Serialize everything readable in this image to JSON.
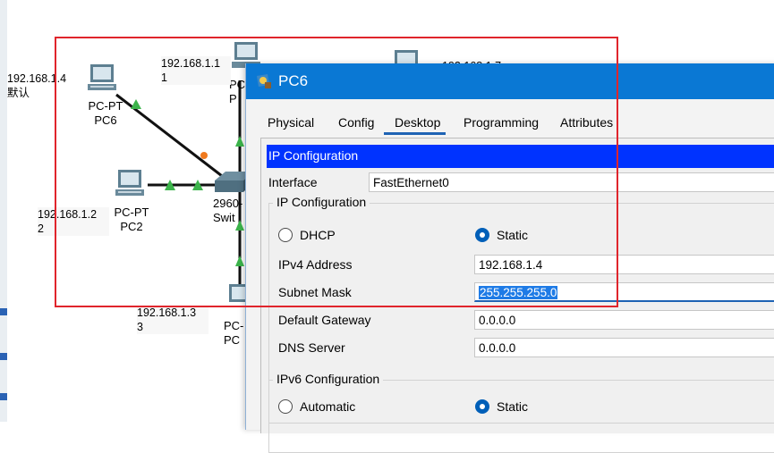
{
  "topology": {
    "pc6": {
      "label1": "PC-PT",
      "label2": "PC6"
    },
    "pc2": {
      "label1": "PC-PT",
      "label2": "PC2"
    },
    "switch": {
      "label1": "2960-",
      "label2": "Swit"
    },
    "pc_top_partial": {
      "label1": "PC",
      "label2": "P"
    },
    "pc_bottom_partial": {
      "label1": "PC-",
      "label2": "PC"
    },
    "notes": {
      "pc6_ip": "192.168.1.4",
      "pc6_extra": "默认",
      "pc_top_ip": "192.168.1.1",
      "pc_top_num": "1",
      "pc2_ip": "192.168.1.2",
      "pc2_num": "2",
      "pc_bottom_ip": "192.168.1.3",
      "pc_bottom_num": "3",
      "far_right_ip": "192.168.1.7"
    },
    "colors": {
      "link": "#111111",
      "link_up": "#3cb44b",
      "link_port": "#f07a1e",
      "highlight": "#e0252c"
    }
  },
  "dialog": {
    "title": "PC6",
    "tabs": [
      "Physical",
      "Config",
      "Desktop",
      "Programming",
      "Attributes"
    ],
    "active_tab": "Desktop",
    "header": "IP Configuration",
    "interface_label": "Interface",
    "interface_value": "FastEthernet0",
    "ipv4_group": "IP Configuration",
    "dhcp_label": "DHCP",
    "static_label": "Static",
    "ipv4_selected": "Static",
    "ipv4_address_label": "IPv4 Address",
    "ipv4_address": "192.168.1.4",
    "subnet_mask_label": "Subnet Mask",
    "subnet_mask": "255.255.255.0",
    "gateway_label": "Default Gateway",
    "gateway": "0.0.0.0",
    "dns_label": "DNS Server",
    "dns": "0.0.0.0",
    "ipv6_group": "IPv6 Configuration",
    "automatic_label": "Automatic",
    "static6_label": "Static",
    "ipv6_selected": "Static",
    "colors": {
      "titlebar": "#0a78d4",
      "header_bar": "#0033ff",
      "radio_on": "#005fb8"
    }
  }
}
